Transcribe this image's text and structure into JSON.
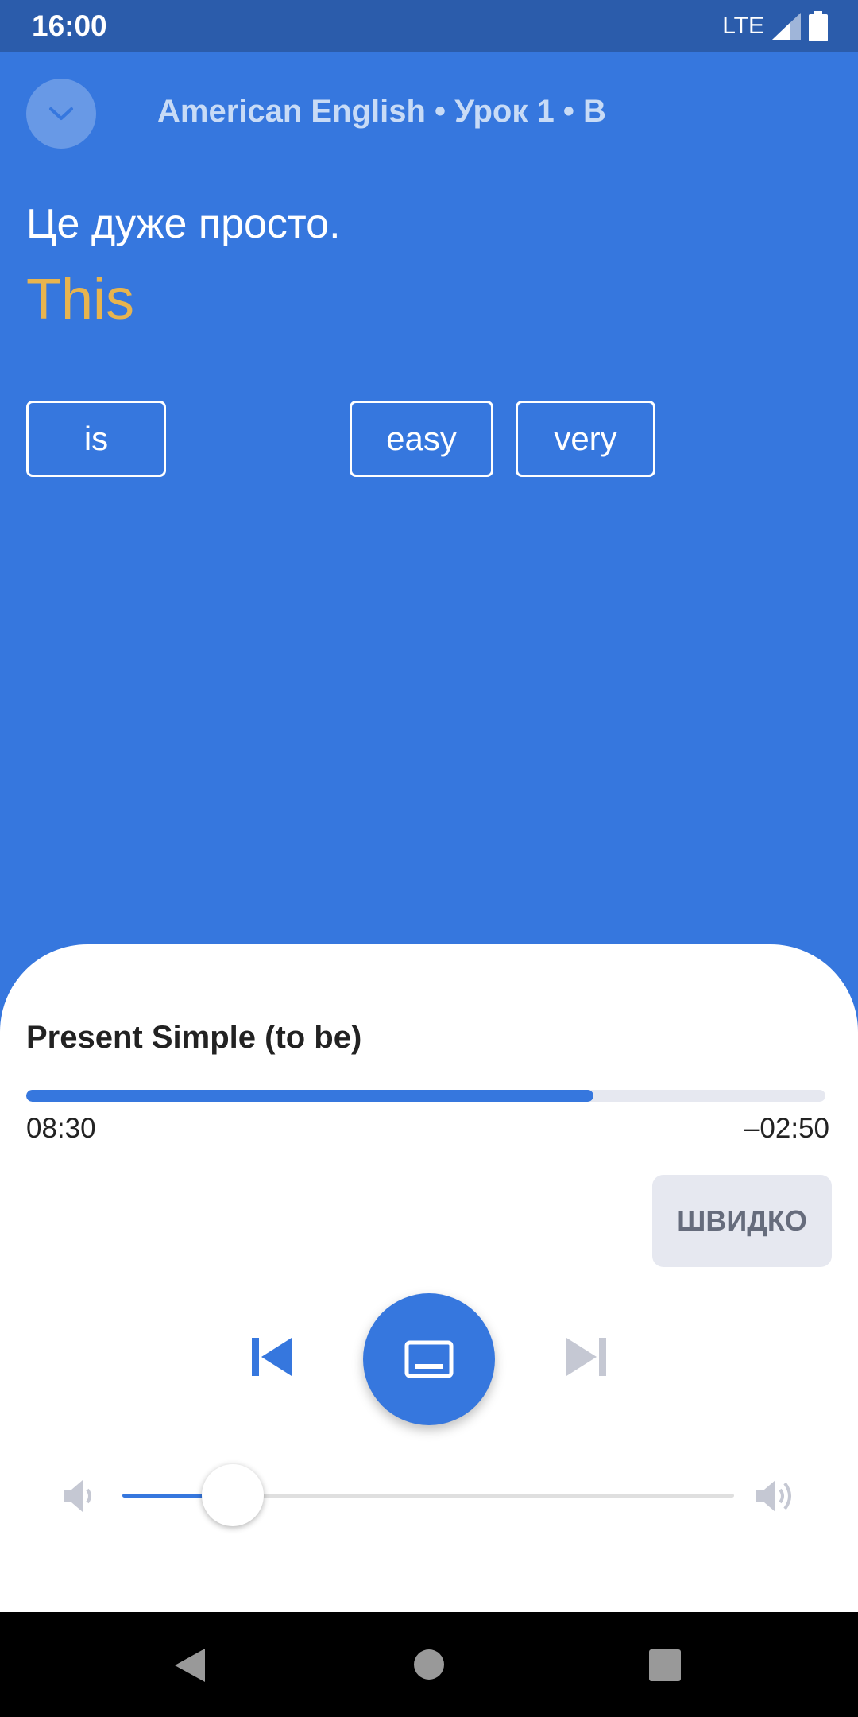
{
  "status_bar": {
    "time": "16:00",
    "network": "LTE"
  },
  "header": {
    "title": "American English • Урок 1 • B"
  },
  "exercise": {
    "sentence": "Це дуже просто.",
    "answer": "This",
    "chips": [
      "is",
      "easy",
      "very"
    ]
  },
  "player": {
    "title": "Present Simple (to be)",
    "progress": 0.71,
    "elapsed": "08:30",
    "remaining": "–02:50",
    "speed_label": "ШВИДКО",
    "volume": 0.18
  },
  "colors": {
    "primary": "#3677DE",
    "status_bar": "#2B5CAB",
    "answer": "#E8B44E",
    "chip_bg": "#E6E8F0"
  },
  "icons": {
    "collapse": "chevron-down-icon",
    "previous": "skip-previous-icon",
    "play": "subtitles-icon",
    "next": "skip-next-icon",
    "volume_low": "volume-low-icon",
    "volume_high": "volume-high-icon"
  }
}
